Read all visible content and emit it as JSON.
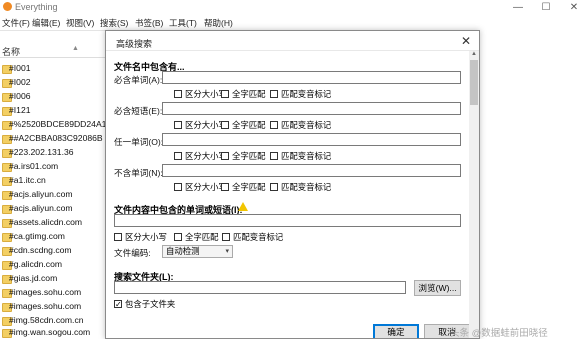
{
  "window": {
    "title": "Everything",
    "controls": [
      "—",
      "☐",
      "✕"
    ]
  },
  "menu": [
    "文件(F)",
    "编辑(E)",
    "视图(V)",
    "搜索(S)",
    "书签(B)",
    "工具(T)",
    "帮助(H)"
  ],
  "list": {
    "column_name": "名称",
    "rows": [
      "#I001",
      "#I002",
      "#I006",
      "#I121",
      "#%2520BDCE89DD24A1",
      "##A2CBBA083C92086B",
      "#223.202.131.36",
      "#a.irs01.com",
      "#a1.itc.cn",
      "#acjs.aliyun.com",
      "#acjs.aliyun.com",
      "#assets.alicdn.com",
      "#ca.gtimg.com",
      "#cdn.scdng.com",
      "#g.alicdn.com",
      "#gias.jd.com",
      "#images.sohu.com",
      "#images.sohu.com",
      "#img.58cdn.com.cn",
      "#img.wan.sogou.com"
    ]
  },
  "dialog": {
    "title": "高级搜索",
    "close": "✕",
    "section_filename": "文件名中包含有...",
    "fields": [
      {
        "label": "必含单词(A):",
        "value": ""
      },
      {
        "label": "必含短语(E):",
        "value": ""
      },
      {
        "label": "任一单词(O):",
        "value": ""
      },
      {
        "label": "不含单词(N):",
        "value": ""
      }
    ],
    "checks": {
      "match_case": "区分大小写",
      "whole_word": "全字匹配",
      "diacritics": "匹配变音标记"
    },
    "section_content": "文件内容中包含的单词或短语(I):",
    "content_value": "",
    "encoding_label": "文件编码:",
    "encoding_value": "自动检测",
    "section_folder": "搜索文件夹(L):",
    "folder_value": "",
    "browse_label": "浏览(W)...",
    "subfolders_label": "包含子文件夹",
    "subfolders_checked": "✓",
    "ok_label": "确定",
    "cancel_label": "取消"
  },
  "watermark": "头条 @数据蛙前田晓径"
}
